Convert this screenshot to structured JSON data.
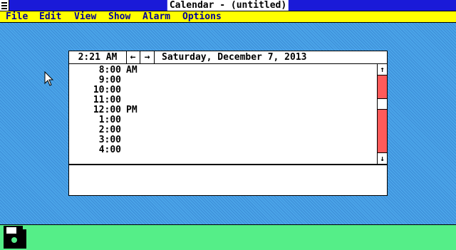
{
  "app": {
    "title": "Calendar - (untitled)"
  },
  "menu": {
    "file": "File",
    "edit": "Edit",
    "view": "View",
    "show": "Show",
    "alarm": "Alarm",
    "options": "Options"
  },
  "calendar": {
    "current_time": "2:21 AM",
    "prev_label": "←",
    "next_label": "→",
    "date": "Saturday, December 7, 2013",
    "slots": [
      {
        "time": "8:00",
        "ampm": "AM"
      },
      {
        "time": "9:00",
        "ampm": ""
      },
      {
        "time": "10:00",
        "ampm": ""
      },
      {
        "time": "11:00",
        "ampm": ""
      },
      {
        "time": "12:00",
        "ampm": "PM"
      },
      {
        "time": "1:00",
        "ampm": ""
      },
      {
        "time": "2:00",
        "ampm": ""
      },
      {
        "time": "3:00",
        "ampm": ""
      },
      {
        "time": "4:00",
        "ampm": ""
      }
    ],
    "scroll_up": "↑",
    "scroll_down": "↓",
    "scroll_position": 0.35,
    "notes": ""
  },
  "colors": {
    "titlebar": "#1a1ad8",
    "menubar": "#ffff00",
    "menu_text": "#00009a",
    "desktop": "#4aa4e8",
    "iconbar": "#55ee88",
    "scroll_track": "#ff5a5a"
  },
  "icons": {
    "system_menu": "system-menu-icon",
    "floppy_disk": "floppy-disk-icon",
    "cursor": "mouse-pointer-icon"
  }
}
